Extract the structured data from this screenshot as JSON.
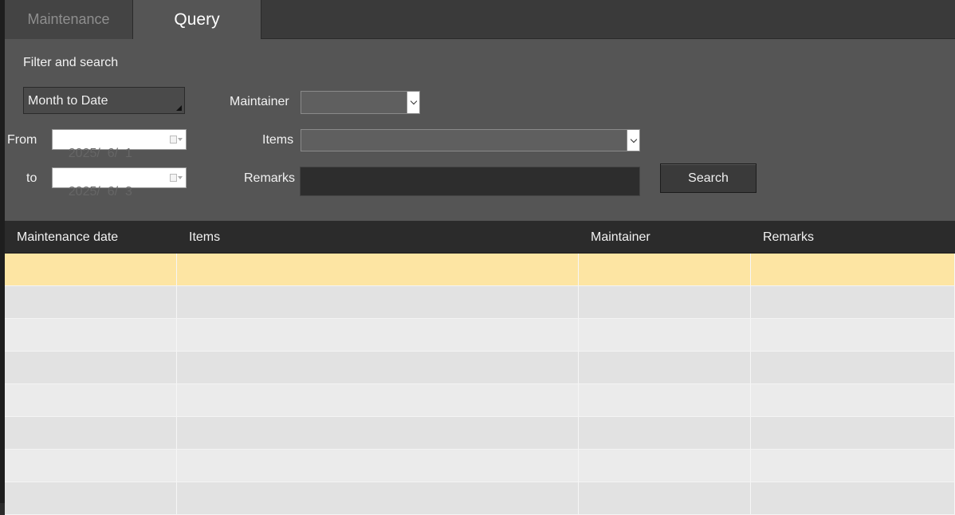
{
  "tabs": {
    "maintenance": "Maintenance",
    "query": "Query",
    "active": "Query"
  },
  "filter": {
    "title": "Filter and search",
    "period": "Month to Date",
    "from_label": "From",
    "to_label": "to",
    "from_date": "2025/  6/  1",
    "to_date": "2025/  6/  3",
    "maintainer_label": "Maintainer",
    "maintainer_value": "",
    "items_label": "Items",
    "items_value": "",
    "remarks_label": "Remarks",
    "remarks_value": "",
    "search_label": "Search"
  },
  "table": {
    "columns": [
      "Maintenance date",
      "Items",
      "Maintainer",
      "Remarks"
    ],
    "rows": [
      [
        "",
        "",
        "",
        ""
      ],
      [
        "",
        "",
        "",
        ""
      ],
      [
        "",
        "",
        "",
        ""
      ],
      [
        "",
        "",
        "",
        ""
      ],
      [
        "",
        "",
        "",
        ""
      ],
      [
        "",
        "",
        "",
        ""
      ],
      [
        "",
        "",
        "",
        ""
      ],
      [
        "",
        "",
        "",
        ""
      ]
    ],
    "selected_row": 0
  },
  "colors": {
    "selected_row": "#fde5a3",
    "row_even": "#e2e2e2",
    "row_odd": "#ebebeb"
  }
}
